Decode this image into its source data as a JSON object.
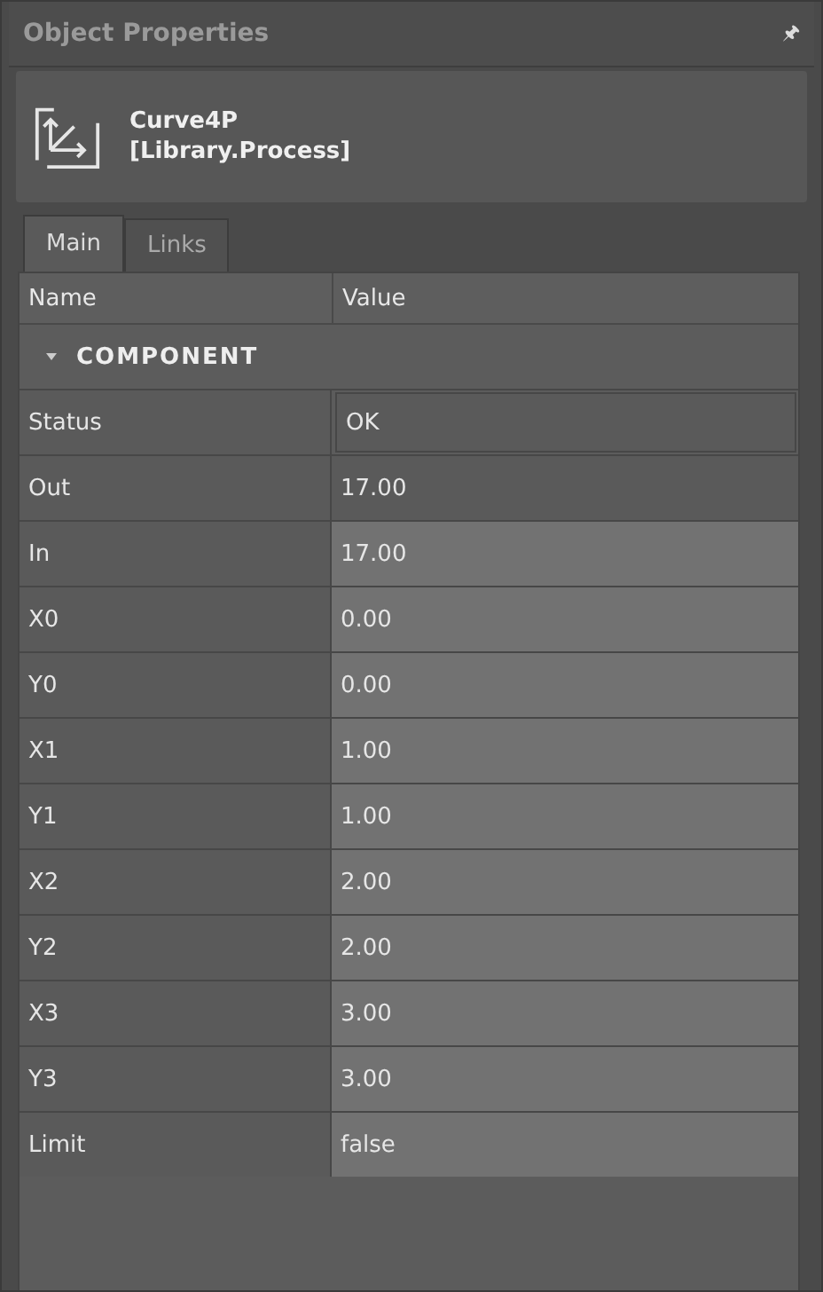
{
  "panel": {
    "title": "Object Properties",
    "pin": "🖈"
  },
  "object": {
    "name": "Curve4P",
    "library": "[Library.Process]"
  },
  "tabs": [
    {
      "label": "Main",
      "selected": true
    },
    {
      "label": "Links",
      "selected": false
    }
  ],
  "table": {
    "columns": [
      "Name",
      "Value"
    ],
    "group": {
      "label": "COMPONENT",
      "expanded": true
    },
    "rows": [
      {
        "name": "Status",
        "value": "OK",
        "kind": "framed"
      },
      {
        "name": "Out",
        "value": "17.00",
        "kind": "readonly"
      },
      {
        "name": "In",
        "value": "17.00",
        "kind": "editable"
      },
      {
        "name": "X0",
        "value": "0.00",
        "kind": "editable"
      },
      {
        "name": "Y0",
        "value": "0.00",
        "kind": "editable"
      },
      {
        "name": "X1",
        "value": "1.00",
        "kind": "editable"
      },
      {
        "name": "Y1",
        "value": "1.00",
        "kind": "editable"
      },
      {
        "name": "X2",
        "value": "2.00",
        "kind": "editable"
      },
      {
        "name": "Y2",
        "value": "2.00",
        "kind": "editable"
      },
      {
        "name": "X3",
        "value": "3.00",
        "kind": "editable"
      },
      {
        "name": "Y3",
        "value": "3.00",
        "kind": "editable"
      },
      {
        "name": "Limit",
        "value": "false",
        "kind": "editable"
      }
    ]
  }
}
